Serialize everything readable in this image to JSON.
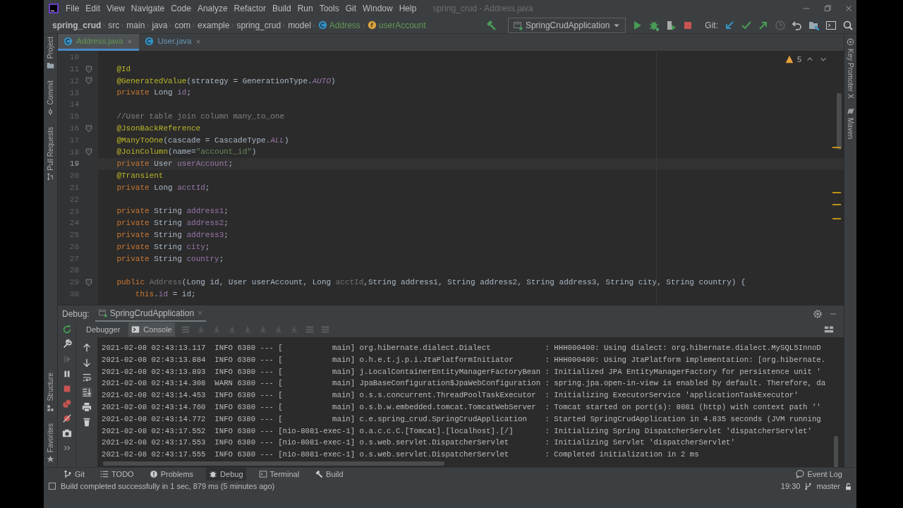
{
  "menu_bar": {
    "items": [
      "File",
      "Edit",
      "View",
      "Navigate",
      "Code",
      "Analyze",
      "Refactor",
      "Build",
      "Run",
      "Tools",
      "Git",
      "Window",
      "Help"
    ],
    "title": "spring_crud - Address.java"
  },
  "breadcrumbs": [
    {
      "text": "spring_crud",
      "kind": "project"
    },
    {
      "text": "src",
      "kind": "folder"
    },
    {
      "text": "main",
      "kind": "folder"
    },
    {
      "text": "java",
      "kind": "folder"
    },
    {
      "text": "com",
      "kind": "folder"
    },
    {
      "text": "example",
      "kind": "folder"
    },
    {
      "text": "spring_crud",
      "kind": "folder"
    },
    {
      "text": "model",
      "kind": "folder"
    },
    {
      "text": "Address",
      "kind": "class"
    },
    {
      "text": "userAccount",
      "kind": "field"
    }
  ],
  "run_config": "SpringCrudApplication",
  "git_label": "Git:",
  "editor_tabs": [
    {
      "label": "Address.java",
      "selected": true,
      "color": "#629755"
    },
    {
      "label": "User.java",
      "selected": false,
      "color": "#6897bb"
    }
  ],
  "left_strip_top": [
    "Project",
    "Commit",
    "Pull Requests"
  ],
  "left_strip_bottom": [
    "Structure",
    "Favorites"
  ],
  "right_strip": [
    "Key Promoter X",
    "Maven"
  ],
  "editor": {
    "warnings": "5",
    "lines": [
      {
        "number": "10",
        "current": false,
        "fold_marker": false
      },
      {
        "number": "11",
        "current": false,
        "fold_marker": true,
        "tokens": [
          {
            "kind": "annotation",
            "text": "    @Id"
          }
        ]
      },
      {
        "number": "12",
        "current": false,
        "fold_marker": true,
        "tokens": [
          {
            "kind": "annotation",
            "text": "    @GeneratedValue"
          },
          {
            "kind": "plain",
            "text": "(strategy = GenerationType."
          },
          {
            "kind": "constant",
            "text": "AUTO"
          },
          {
            "kind": "plain",
            "text": ")"
          }
        ]
      },
      {
        "number": "13",
        "current": false,
        "fold_marker": false,
        "tokens": [
          {
            "kind": "keyword",
            "text": "    private "
          },
          {
            "kind": "plain",
            "text": "Long "
          },
          {
            "kind": "field",
            "text": "id"
          },
          {
            "kind": "plain",
            "text": ";"
          }
        ]
      },
      {
        "number": "14",
        "current": false,
        "fold_marker": false
      },
      {
        "number": "15",
        "current": false,
        "fold_marker": false,
        "tokens": [
          {
            "kind": "comment",
            "text": "    //User table join column many_to_one"
          }
        ]
      },
      {
        "number": "16",
        "current": false,
        "fold_marker": true,
        "tokens": [
          {
            "kind": "annotation",
            "text": "    @JsonBackReference"
          }
        ]
      },
      {
        "number": "17",
        "current": false,
        "fold_marker": false,
        "tokens": [
          {
            "kind": "annotation",
            "text": "    @ManyToOne"
          },
          {
            "kind": "plain",
            "text": "(cascade = CascadeType."
          },
          {
            "kind": "constant",
            "text": "ALL"
          },
          {
            "kind": "plain",
            "text": ")"
          }
        ]
      },
      {
        "number": "18",
        "current": false,
        "fold_marker": true,
        "tokens": [
          {
            "kind": "annotation",
            "text": "    @JoinColumn"
          },
          {
            "kind": "plain",
            "text": "(name="
          },
          {
            "kind": "string",
            "text": "\"account_id\""
          },
          {
            "kind": "plain",
            "text": ")"
          }
        ]
      },
      {
        "number": "19",
        "current": true,
        "fold_marker": false,
        "tokens": [
          {
            "kind": "keyword",
            "text": "    private "
          },
          {
            "kind": "plain",
            "text": "User "
          },
          {
            "kind": "field",
            "text": "userAccount"
          },
          {
            "kind": "plain",
            "text": ";"
          }
        ]
      },
      {
        "number": "20",
        "current": false,
        "fold_marker": false,
        "tokens": [
          {
            "kind": "annotation",
            "text": "    @Transient"
          }
        ]
      },
      {
        "number": "21",
        "current": false,
        "fold_marker": false,
        "tokens": [
          {
            "kind": "keyword",
            "text": "    private "
          },
          {
            "kind": "plain",
            "text": "Long "
          },
          {
            "kind": "field",
            "text": "acctId"
          },
          {
            "kind": "plain",
            "text": ";"
          }
        ]
      },
      {
        "number": "22",
        "current": false,
        "fold_marker": false
      },
      {
        "number": "23",
        "current": false,
        "fold_marker": false,
        "tokens": [
          {
            "kind": "keyword",
            "text": "    private "
          },
          {
            "kind": "plain",
            "text": "String "
          },
          {
            "kind": "field",
            "text": "address1"
          },
          {
            "kind": "plain",
            "text": ";"
          }
        ]
      },
      {
        "number": "24",
        "current": false,
        "fold_marker": false,
        "tokens": [
          {
            "kind": "keyword",
            "text": "    private "
          },
          {
            "kind": "plain",
            "text": "String "
          },
          {
            "kind": "field",
            "text": "address2"
          },
          {
            "kind": "plain",
            "text": ";"
          }
        ]
      },
      {
        "number": "25",
        "current": false,
        "fold_marker": false,
        "tokens": [
          {
            "kind": "keyword",
            "text": "    private "
          },
          {
            "kind": "plain",
            "text": "String "
          },
          {
            "kind": "field",
            "text": "address3"
          },
          {
            "kind": "plain",
            "text": ";"
          }
        ]
      },
      {
        "number": "26",
        "current": false,
        "fold_marker": false,
        "tokens": [
          {
            "kind": "keyword",
            "text": "    private "
          },
          {
            "kind": "plain",
            "text": "String "
          },
          {
            "kind": "field",
            "text": "city"
          },
          {
            "kind": "plain",
            "text": ";"
          }
        ]
      },
      {
        "number": "27",
        "current": false,
        "fold_marker": false,
        "tokens": [
          {
            "kind": "keyword",
            "text": "    private "
          },
          {
            "kind": "plain",
            "text": "String "
          },
          {
            "kind": "field",
            "text": "country"
          },
          {
            "kind": "plain",
            "text": ";"
          }
        ]
      },
      {
        "number": "28",
        "current": false,
        "fold_marker": false
      },
      {
        "number": "29",
        "current": false,
        "fold_marker": true,
        "tokens": [
          {
            "kind": "keyword",
            "text": "    public "
          },
          {
            "kind": "unused",
            "text": "Address"
          },
          {
            "kind": "plain",
            "text": "(Long id, User userAccount, Long "
          },
          {
            "kind": "unused",
            "text": "acctId"
          },
          {
            "kind": "plain",
            "text": ",String address1, String address2, String address3, String city, String country) {"
          }
        ]
      },
      {
        "number": "30",
        "current": false,
        "fold_marker": false,
        "tokens": [
          {
            "kind": "keyword",
            "text": "        this"
          },
          {
            "kind": "plain",
            "text": "."
          },
          {
            "kind": "field",
            "text": "id"
          },
          {
            "kind": "plain",
            "text": " = id;"
          }
        ]
      }
    ]
  },
  "debug": {
    "label": "Debug:",
    "session_tab": "SpringCrudApplication",
    "tabs": [
      {
        "label": "Debugger",
        "selected": false
      },
      {
        "label": "Console",
        "selected": true
      }
    ],
    "console_lines": [
      "2021-02-08 02:43:13.117  INFO 6380 --- [           main] org.hibernate.dialect.Dialect            : HHH000400: Using dialect: org.hibernate.dialect.MySQL5InnoD",
      "2021-02-08 02:43:13.884  INFO 6380 --- [           main] o.h.e.t.j.p.i.JtaPlatformInitiator       : HHH000490: Using JtaPlatform implementation: [org.hibernate.",
      "2021-02-08 02:43:13.893  INFO 6380 --- [           main] j.LocalContainerEntityManagerFactoryBean : Initialized JPA EntityManagerFactory for persistence unit '",
      "2021-02-08 02:43:14.308  WARN 6380 --- [           main] JpaBaseConfiguration$JpaWebConfiguration : spring.jpa.open-in-view is enabled by default. Therefore, da",
      "2021-02-08 02:43:14.453  INFO 6380 --- [           main] o.s.s.concurrent.ThreadPoolTaskExecutor  : Initializing ExecutorService 'applicationTaskExecutor'",
      "2021-02-08 02:43:14.760  INFO 6380 --- [           main] o.s.b.w.embedded.tomcat.TomcatWebServer  : Tomcat started on port(s): 8081 (http) with context path ''",
      "2021-02-08 02:43:14.772  INFO 6380 --- [           main] c.e.spring_crud.SpringCrudApplication    : Started SpringCrudApplication in 4.835 seconds (JVM running",
      "2021-02-08 02:43:17.552  INFO 6380 --- [nio-8081-exec-1] o.a.c.c.C.[Tomcat].[localhost].[/]       : Initializing Spring DispatcherServlet 'dispatcherServlet'",
      "2021-02-08 02:43:17.553  INFO 6380 --- [nio-8081-exec-1] o.s.web.servlet.DispatcherServlet        : Initializing Servlet 'dispatcherServlet'",
      "2021-02-08 02:43:17.555  INFO 6380 --- [nio-8081-exec-1] o.s.web.servlet.DispatcherServlet        : Completed initialization in 2 ms"
    ]
  },
  "tool_windows": [
    {
      "label": "Git",
      "kind": "git",
      "selected": false
    },
    {
      "label": "TODO",
      "kind": "todo",
      "selected": false
    },
    {
      "label": "Problems",
      "kind": "problems",
      "selected": false
    },
    {
      "label": "Debug",
      "kind": "debug",
      "selected": true
    },
    {
      "label": "Terminal",
      "kind": "terminal",
      "selected": false
    },
    {
      "label": "Build",
      "kind": "build",
      "selected": false
    }
  ],
  "event_log": "Event Log",
  "status_bar": {
    "message": "Build completed successfully in 1 sec, 879 ms (5 minutes ago)",
    "time": "19:30",
    "branch": "master"
  }
}
